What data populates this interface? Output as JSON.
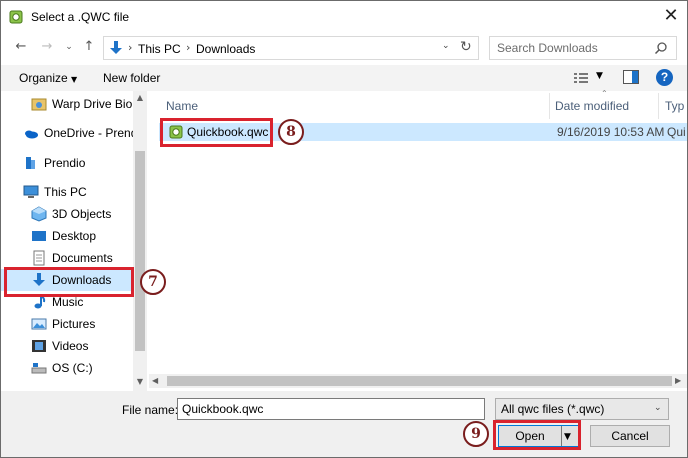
{
  "window": {
    "title": "Select a .QWC file"
  },
  "address": {
    "crumbs": [
      "This PC",
      "Downloads"
    ],
    "search_placeholder": "Search Downloads"
  },
  "toolbar": {
    "organize": "Organize",
    "new_folder": "New folder",
    "help": "?"
  },
  "sidebar": {
    "items": [
      {
        "label": "Warp Drive Bio",
        "icon": "warp-drive-icon"
      },
      {
        "label": "OneDrive - Prendi",
        "icon": "onedrive-icon"
      },
      {
        "label": "Prendio",
        "icon": "user-folder-icon"
      },
      {
        "label": "This PC",
        "icon": "computer-icon"
      },
      {
        "label": "3D Objects",
        "icon": "3d-objects-icon"
      },
      {
        "label": "Desktop",
        "icon": "desktop-icon"
      },
      {
        "label": "Documents",
        "icon": "documents-icon"
      },
      {
        "label": "Downloads",
        "icon": "downloads-icon"
      },
      {
        "label": "Music",
        "icon": "music-icon"
      },
      {
        "label": "Pictures",
        "icon": "pictures-icon"
      },
      {
        "label": "Videos",
        "icon": "videos-icon"
      },
      {
        "label": "OS (C:)",
        "icon": "drive-icon"
      }
    ],
    "selected": "Downloads"
  },
  "filelist": {
    "columns": [
      "Name",
      "Date modified",
      "Typ"
    ],
    "rows": [
      {
        "name": "Quickbook.qwc",
        "date": "9/16/2019 10:53 AM",
        "type": "Qui"
      }
    ]
  },
  "bottom": {
    "file_name_label": "File name:",
    "file_name_value": "Quickbook.qwc",
    "file_type": "All qwc files (*.qwc)",
    "open": "Open",
    "cancel": "Cancel"
  },
  "annotations": {
    "step7": "7",
    "step8": "8",
    "step9": "9"
  },
  "colors": {
    "highlight": "#d9232e",
    "selection": "#cce8ff",
    "accent": "#0078d7"
  }
}
